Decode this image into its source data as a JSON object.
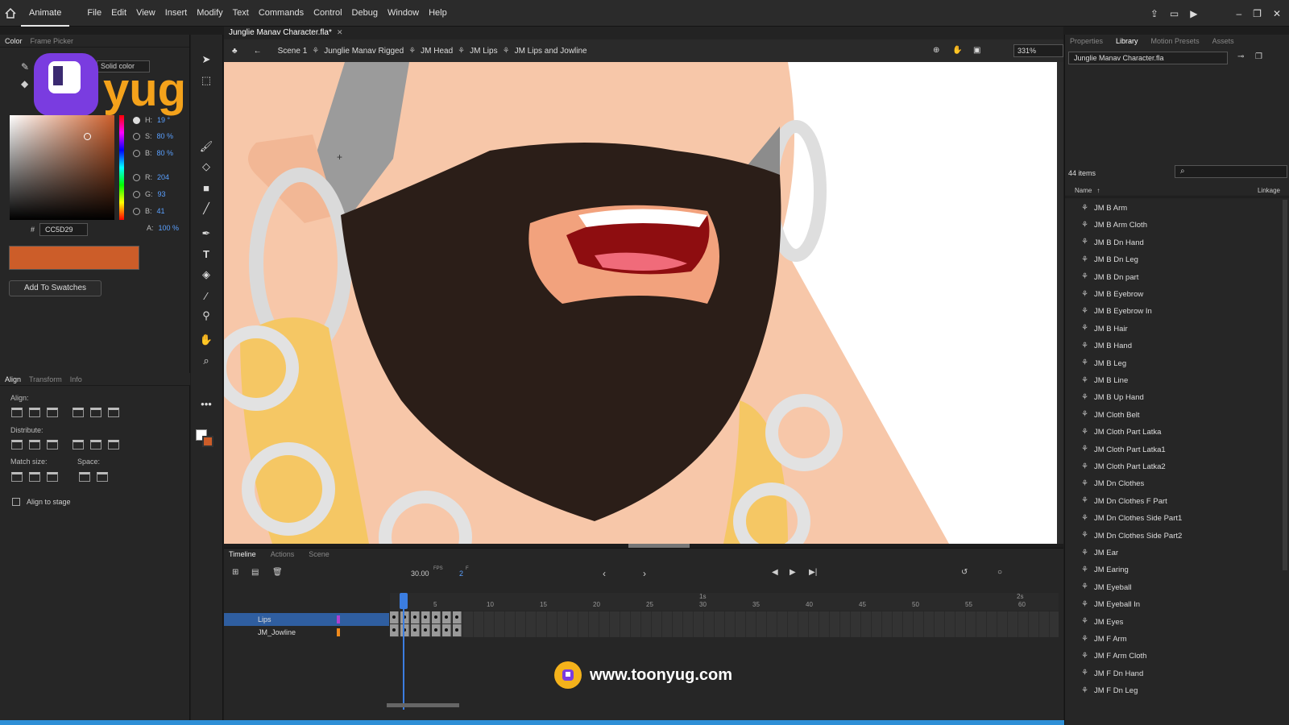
{
  "menubar": {
    "app": "Animate",
    "items": [
      "File",
      "Edit",
      "View",
      "Insert",
      "Modify",
      "Text",
      "Commands",
      "Control",
      "Debug",
      "Window",
      "Help"
    ]
  },
  "left": {
    "tabs": [
      "Color",
      "Frame Picker"
    ],
    "color_type": "Solid color",
    "hsb": [
      {
        "label": "H:",
        "value": "19 °"
      },
      {
        "label": "S:",
        "value": "80 %"
      },
      {
        "label": "B:",
        "value": "80 %"
      }
    ],
    "rgb": [
      {
        "label": "R:",
        "value": "204"
      },
      {
        "label": "G:",
        "value": "93"
      },
      {
        "label": "B:",
        "value": "41"
      }
    ],
    "alpha": {
      "label": "A:",
      "value": "100 %"
    },
    "hex_label": "#",
    "hex": "CC5D29",
    "swatch_color": "#cc5d29",
    "add_swatches": "Add To Swatches",
    "align_tabs": [
      "Align",
      "Transform",
      "Info"
    ],
    "align_label": "Align:",
    "distribute_label": "Distribute:",
    "match_label": "Match size:",
    "space_label": "Space:",
    "align_to_stage": "Align to stage"
  },
  "document": {
    "tab": "Junglie Manav Character.fla*",
    "breadcrumb": [
      "Scene 1",
      "Junglie Manav Rigged",
      "JM Head",
      "JM Lips",
      "JM Lips and Jowline"
    ],
    "zoom": "331%"
  },
  "timeline": {
    "tabs": [
      "Timeline",
      "Actions",
      "Scene"
    ],
    "fps": "30.00",
    "fps_unit": "FPS",
    "frame": "2",
    "frame_unit": "F",
    "ticks": [
      "5",
      "10",
      "15",
      "20",
      "25",
      "30",
      "35",
      "40",
      "45",
      "50",
      "55",
      "60"
    ],
    "seconds": [
      "1s",
      "2s"
    ],
    "layers": [
      {
        "name": "Lips",
        "color": "#b040d0"
      },
      {
        "name": "JM_Jowline",
        "color": "#f08a1c"
      }
    ]
  },
  "watermark": {
    "url": "www.toonyug.com",
    "logo_text": "Ayug"
  },
  "library": {
    "tabs": [
      "Properties",
      "Library",
      "Motion Presets",
      "Assets"
    ],
    "file": "Junglie Manav Character.fla",
    "count": "44 items",
    "col_name": "Name",
    "col_linkage": "Linkage",
    "items": [
      "JM B Arm",
      "JM B Arm Cloth",
      "JM B Dn Hand",
      "JM B Dn Leg",
      "JM B Dn part",
      "JM B Eyebrow",
      "JM B Eyebrow In",
      "JM B Hair",
      "JM B Hand",
      "JM B Leg",
      "JM B Line",
      "JM B Up Hand",
      "JM Cloth Belt",
      "JM Cloth Part Latka",
      "JM Cloth Part Latka1",
      "JM Cloth Part Latka2",
      "JM Dn Clothes",
      "JM Dn Clothes F Part",
      "JM Dn Clothes Side Part1",
      "JM Dn Clothes Side Part2",
      "JM Ear",
      "JM Earing",
      "JM Eyeball",
      "JM Eyeball In",
      "JM Eyes",
      "JM F Arm",
      "JM F Arm Cloth",
      "JM F Dn Hand",
      "JM F Dn Leg"
    ]
  }
}
